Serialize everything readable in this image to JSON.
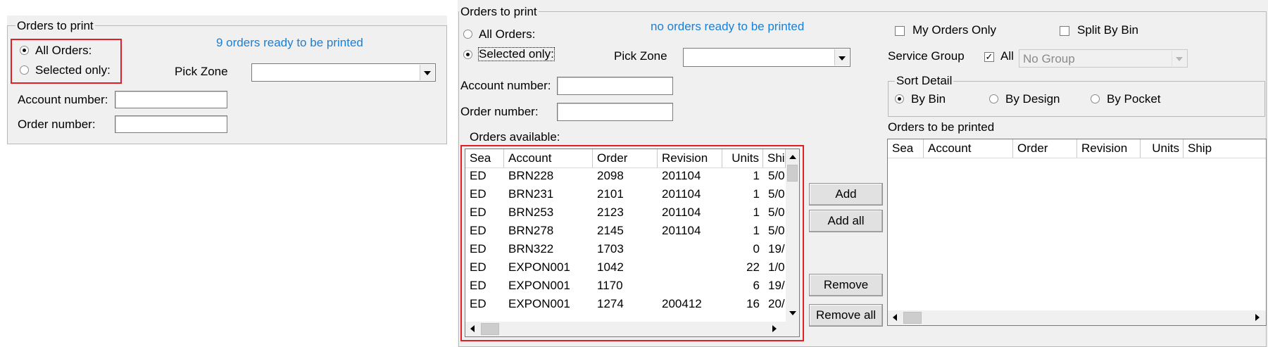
{
  "left_panel": {
    "group_title": "Orders to print",
    "radio_all_label": "All Orders:",
    "radio_selected_label": "Selected only:",
    "status_text": "9 orders  ready to be printed",
    "pick_zone_label": "Pick Zone",
    "pick_zone_value": "",
    "account_label": "Account number:",
    "account_value": "",
    "order_label": "Order number:",
    "order_value": ""
  },
  "right_panel": {
    "group_title": "Orders to print",
    "radio_all_label": "All Orders:",
    "radio_selected_label": "Selected only:",
    "status_text": "no orders ready to be printed",
    "pick_zone_label": "Pick Zone",
    "pick_zone_value": "",
    "account_label": "Account number:",
    "account_value": "",
    "order_label": "Order number:",
    "order_value": "",
    "my_orders_label": "My Orders Only",
    "split_by_bin_label": "Split By Bin",
    "service_group_label": "Service Group",
    "all_label": "All",
    "service_group_value": "No Group",
    "sort_detail_title": "Sort Detail",
    "sort_options": [
      "By Bin",
      "By Design",
      "By Pocket"
    ],
    "orders_available_label": "Orders available:",
    "orders_to_print_label": "Orders to be printed",
    "columns": [
      "Sea",
      "Account",
      "Order",
      "Revision",
      "Units",
      "Shi"
    ],
    "columns_right": [
      "Sea",
      "Account",
      "Order",
      "Revision",
      "Units",
      "Ship"
    ],
    "rows": [
      [
        "ED",
        "BRN228",
        "2098",
        "201104",
        "1",
        "5/0"
      ],
      [
        "ED",
        "BRN231",
        "2101",
        "201104",
        "1",
        "5/0"
      ],
      [
        "ED",
        "BRN253",
        "2123",
        "201104",
        "1",
        "5/0"
      ],
      [
        "ED",
        "BRN278",
        "2145",
        "201104",
        "1",
        "5/0"
      ],
      [
        "ED",
        "BRN322",
        "1703",
        "",
        "0",
        "19/"
      ],
      [
        "ED",
        "EXPON001",
        "1042",
        "",
        "22",
        "1/0"
      ],
      [
        "ED",
        "EXPON001",
        "1170",
        "",
        "6",
        "19/"
      ],
      [
        "ED",
        "EXPON001",
        "1274",
        "200412",
        "16",
        "20/"
      ]
    ],
    "buttons": {
      "add": "Add",
      "add_all": "Add all",
      "remove": "Remove",
      "remove_all": "Remove all"
    }
  },
  "colors": {
    "highlight": "#e01f26",
    "status_blue": "#1a7fd6",
    "panel_bg": "#f0f0f0"
  }
}
